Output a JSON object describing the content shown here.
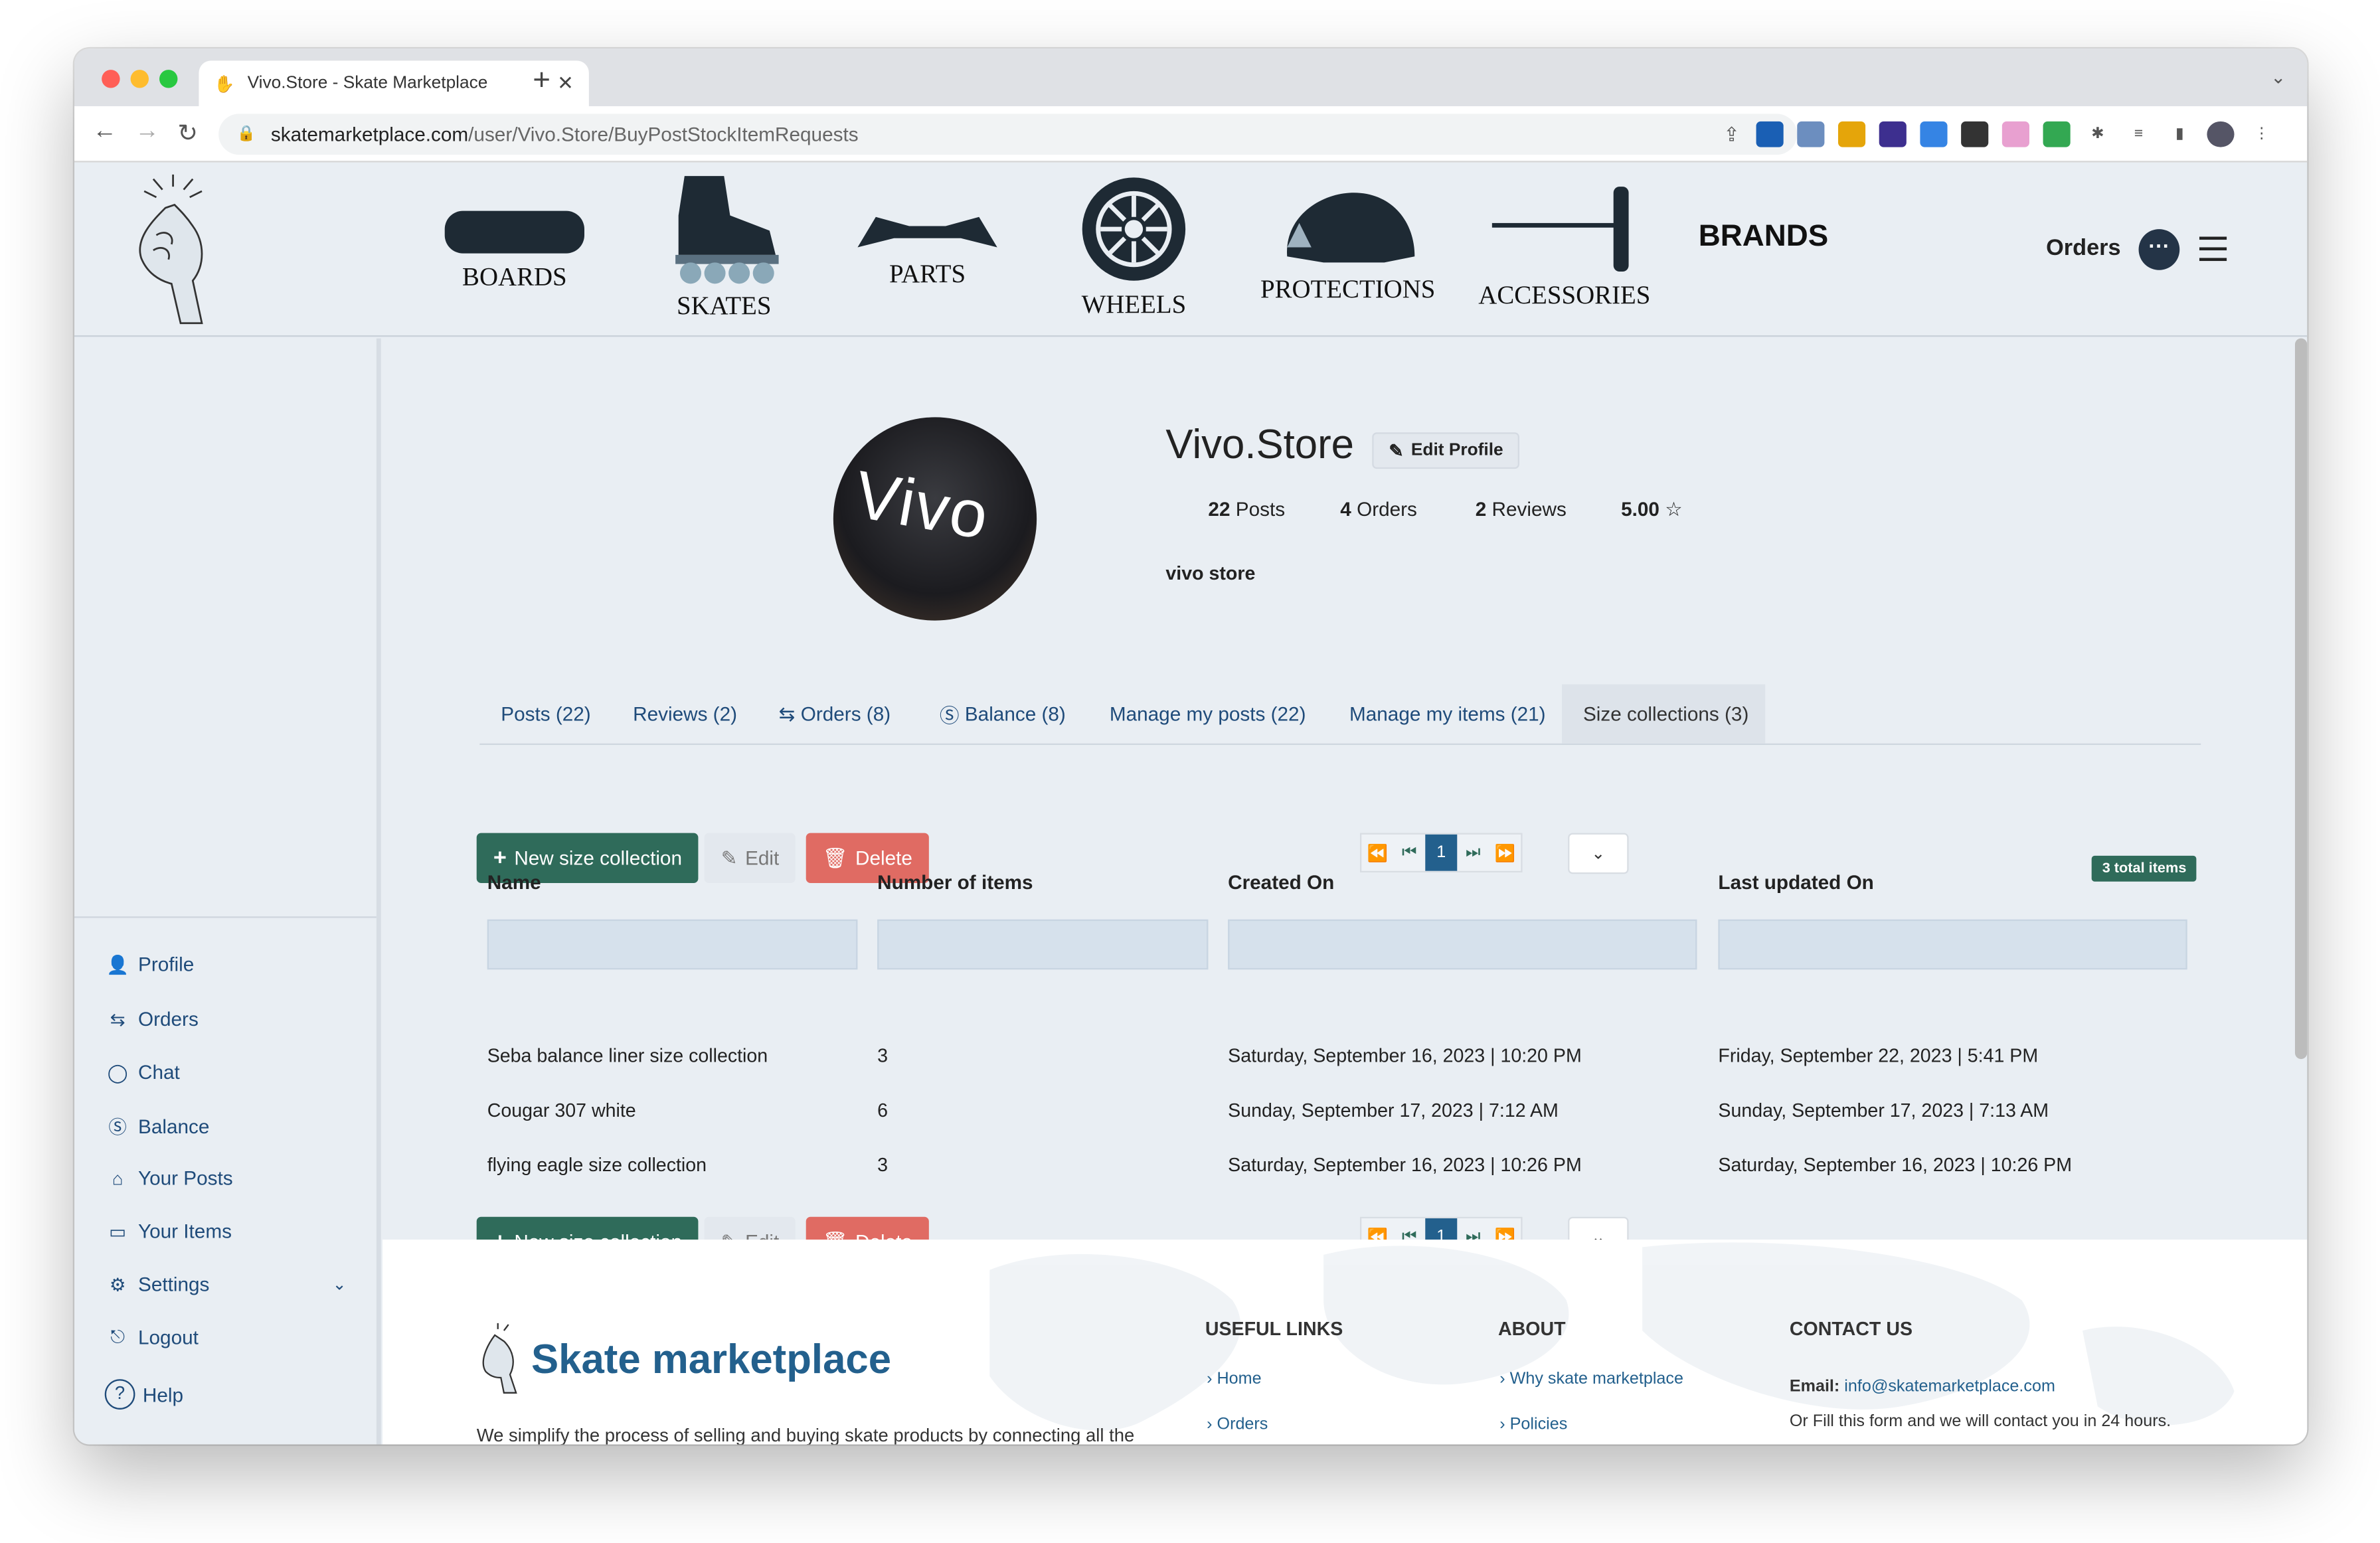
{
  "browser": {
    "tab_title": "Vivo.Store - Skate Marketplace",
    "tab_close": "✕",
    "new_tab": "+",
    "url_host": "skatemarketplace.com",
    "url_path": "/user/Vivo.Store/BuyPostStockItemRequests"
  },
  "header": {
    "categories": [
      "BOARDS",
      "SKATES",
      "PARTS",
      "WHEELS",
      "PROTECTIONS",
      "ACCESSORIES"
    ],
    "brands": "BRANDS",
    "orders": "Orders"
  },
  "sidebar": {
    "items": [
      {
        "label": "Profile",
        "icon": "user-icon"
      },
      {
        "label": "Orders",
        "icon": "swap-icon"
      },
      {
        "label": "Chat",
        "icon": "chat-icon"
      },
      {
        "label": "Balance",
        "icon": "dollar-circle-icon"
      },
      {
        "label": "Your Posts",
        "icon": "store-icon"
      },
      {
        "label": "Your Items",
        "icon": "box-icon"
      },
      {
        "label": "Settings",
        "icon": "gear-icon"
      },
      {
        "label": "Logout",
        "icon": "logout-icon"
      },
      {
        "label": "Help",
        "icon": "help-icon"
      }
    ]
  },
  "profile": {
    "avatar_text": "Vivo",
    "name": "Vivo.Store",
    "edit_label": "Edit Profile",
    "posts_count": "22",
    "posts_label": "Posts",
    "orders_count": "4",
    "orders_label": "Orders",
    "reviews_count": "2",
    "reviews_label": "Reviews",
    "rating": "5.00",
    "description": "vivo store"
  },
  "tabs": [
    {
      "label": "Posts (22)"
    },
    {
      "label": "Reviews (2)"
    },
    {
      "label": "Orders (8)"
    },
    {
      "label": "Balance (8)"
    },
    {
      "label": "Manage my posts (22)"
    },
    {
      "label": "Manage my items (21)"
    },
    {
      "label": "Size collections (3)",
      "active": true
    }
  ],
  "toolbar": {
    "new_label": "New size collection",
    "edit_label": "Edit",
    "delete_label": "Delete",
    "current_page": "1",
    "total_items": "3 total items"
  },
  "table": {
    "columns": [
      "Name",
      "Number of items",
      "Created On",
      "Last updated On"
    ],
    "rows": [
      [
        "Seba balance liner size collection",
        "3",
        "Saturday, September 16, 2023 | 10:20 PM",
        "Friday, September 22, 2023 | 5:41 PM"
      ],
      [
        "Cougar 307 white",
        "6",
        "Sunday, September 17, 2023 | 7:12 AM",
        "Sunday, September 17, 2023 | 7:13 AM"
      ],
      [
        "flying eagle size collection",
        "3",
        "Saturday, September 16, 2023 | 10:26 PM",
        "Saturday, September 16, 2023 | 10:26 PM"
      ]
    ]
  },
  "footer": {
    "brand": "Skate marketplace",
    "description": "We simplify the process of selling and buying skate products by connecting all the",
    "useful_links_title": "USEFUL LINKS",
    "useful_links": [
      "Home",
      "Orders"
    ],
    "about_title": "ABOUT",
    "about_links": [
      "Why skate marketplace",
      "Policies"
    ],
    "contact_title": "CONTACT US",
    "email_label": "Email:",
    "email": "info@skatemarketplace.com",
    "contact_note": "Or Fill this form and we will contact you in 24 hours."
  },
  "colors": {
    "accent_green": "#2f6b5a",
    "link_blue": "#1f4b7a",
    "delete_red": "#e06b63",
    "brand_blue": "#23608d"
  }
}
